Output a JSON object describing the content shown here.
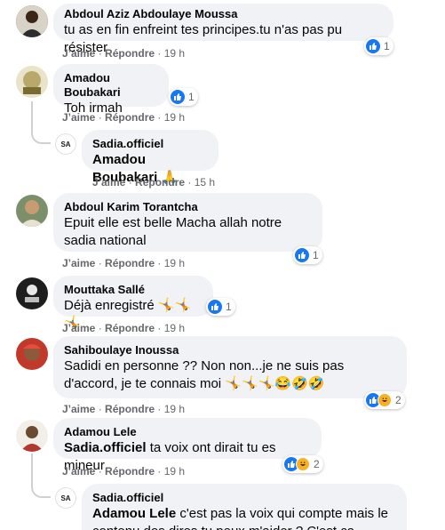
{
  "actions": {
    "like": "J’aime",
    "reply": "Répondre",
    "sep": "·"
  },
  "comments": [
    {
      "author": "Abdoul Aziz Abdoulaye Moussa",
      "text": "tu as en fin enfreint tes principes.tu n'as pas pu résister",
      "time": "19 h",
      "reactions": {
        "icons": [
          "like-icon"
        ],
        "count": "1"
      }
    },
    {
      "author": "Amadou Boubakari",
      "text": "Toh irmah",
      "time": "19 h",
      "reactions": {
        "icons": [
          "like-icon"
        ],
        "count": "1"
      },
      "reply": {
        "author": "Sadia.officiel",
        "mention": "Amadou Boubakari",
        "emoji": "🙏",
        "time": "15 h"
      }
    },
    {
      "author": "Abdoul Karim Torantcha",
      "text": "Epuit elle est belle Macha allah notre sadia national",
      "time": "19 h",
      "reactions": {
        "icons": [
          "like-icon"
        ],
        "count": "1"
      }
    },
    {
      "author": "Mouttaka Sallé",
      "text": "Déjà enregistré 🤸🤸🤸",
      "time": "19 h",
      "reactions": {
        "icons": [
          "like-icon"
        ],
        "count": "1"
      }
    },
    {
      "author": "Sahiboulaye Inoussa",
      "text": "Sadidi en personne ?? Non non...je ne suis pas d'accord, je te connais moi 🤸🤸🤸😂🤣🤣",
      "time": "19 h",
      "reactions": {
        "icons": [
          "like-icon",
          "haha-icon"
        ],
        "count": "2"
      }
    },
    {
      "author": "Adamou Lele",
      "mention": "Sadia.officiel",
      "text": "ta voix ont dirait tu es mineur",
      "time": "19 h",
      "reactions": {
        "icons": [
          "like-icon",
          "haha-icon"
        ],
        "count": "2"
      },
      "reply": {
        "author": "Sadia.officiel",
        "mention": "Adamou Lele",
        "text": "c'est pas la voix qui compte mais le contenu des dires tu peux m'aider ? C'est ca"
      }
    }
  ],
  "reply_logo_text": "SA",
  "colors": {
    "bubble": "#f0f2f5",
    "meta": "#65676b",
    "like": "#1877f2",
    "haha": "#f7b125"
  }
}
